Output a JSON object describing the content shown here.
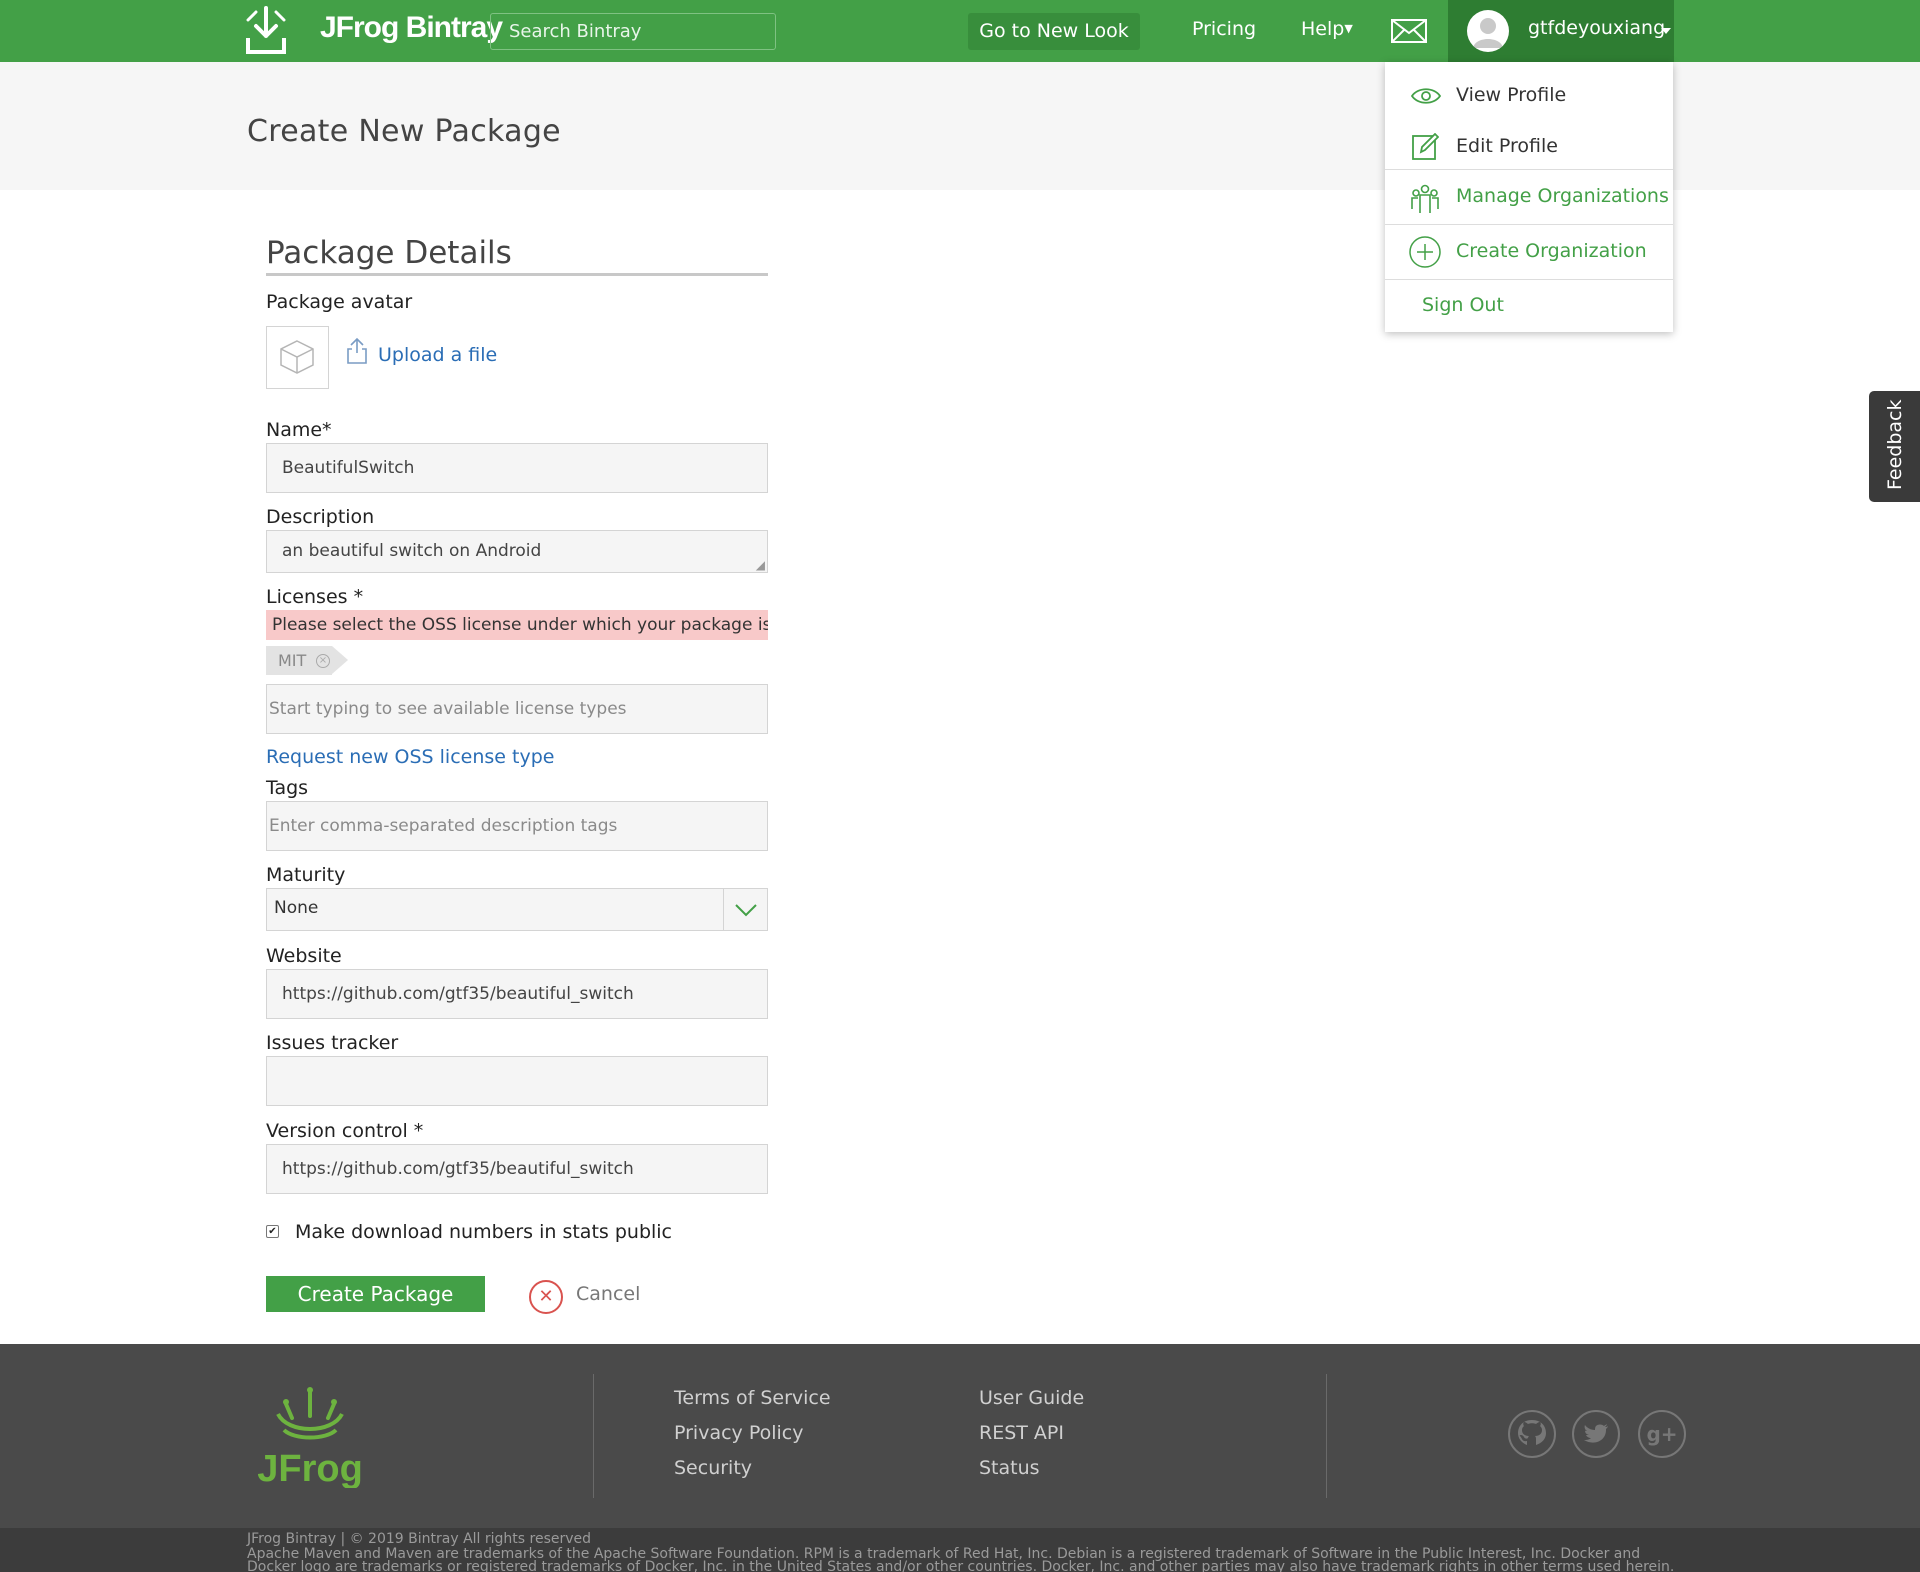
{
  "header": {
    "brand": "JFrog Bintray",
    "search_placeholder": "Search Bintray",
    "go_new_look": "Go to New Look",
    "pricing": "Pricing",
    "help": "Help",
    "username": "gtfdeyouxiang",
    "brand_color": "#43a047"
  },
  "page": {
    "title": "Create New Package"
  },
  "form": {
    "section_title": "Package Details",
    "avatar_label": "Package avatar",
    "upload_link": "Upload a file",
    "name_label": "Name*",
    "name_value": "BeautifulSwitch",
    "description_label": "Description",
    "description_value": "an beautiful switch on Android",
    "licenses_label": "Licenses *",
    "license_warning": "Please select the OSS license under which your package is dis...",
    "license_tag": "MIT",
    "license_placeholder": "Start typing to see available license types",
    "request_license_link": "Request new OSS license type",
    "tags_label": "Tags",
    "tags_placeholder": "Enter comma-separated description tags",
    "maturity_label": "Maturity",
    "maturity_value": "None",
    "website_label": "Website",
    "website_value": "https://github.com/gtf35/beautiful_switch",
    "issues_label": "Issues tracker",
    "issues_value": "",
    "vcs_label": "Version control *",
    "vcs_value": "https://github.com/gtf35/beautiful_switch",
    "stats_public_label": "Make download numbers in stats public",
    "stats_public_checked": true,
    "create_button": "Create Package",
    "cancel_label": "Cancel"
  },
  "user_menu": {
    "items": [
      {
        "label": "View Profile",
        "icon": "eye-icon"
      },
      {
        "label": "Edit Profile",
        "icon": "edit-icon"
      },
      {
        "label": "Manage Organizations",
        "icon": "organizations-icon"
      },
      {
        "label": "Create Organization",
        "icon": "plus-circle-icon"
      },
      {
        "label": "Sign Out",
        "icon": ""
      }
    ]
  },
  "feedback": {
    "label": "Feedback"
  },
  "footer": {
    "logo_text": "JFrog",
    "links_col1": [
      "Terms of Service",
      "Privacy Policy",
      "Security"
    ],
    "links_col2": [
      "User Guide",
      "REST API",
      "Status"
    ],
    "social": [
      "github-icon",
      "twitter-icon",
      "google-plus-icon"
    ],
    "copyright": "JFrog Bintray | © 2019 Bintray All rights reserved",
    "trademark": "Apache Maven and Maven are trademarks of the Apache Software Foundation. RPM is a trademark of Red Hat, Inc. Debian is a registered trademark of Software in the Public Interest, Inc. Docker and Docker logo are trademarks or registered trademarks of Docker, Inc. in the United States and/or other countries. Docker, Inc. and other parties may also have trademark rights in other terms used herein."
  }
}
